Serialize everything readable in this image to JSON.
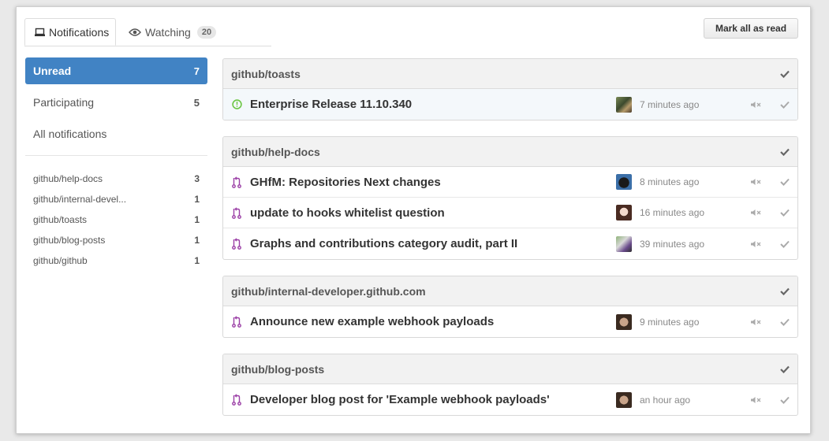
{
  "tabs": {
    "notifications_label": "Notifications",
    "watching_label": "Watching",
    "watching_count": "20"
  },
  "mark_all_label": "Mark all as read",
  "sidebar": {
    "filters": [
      {
        "label": "Unread",
        "count": "7"
      },
      {
        "label": "Participating",
        "count": "5"
      },
      {
        "label": "All notifications",
        "count": ""
      }
    ],
    "repos": [
      {
        "label": "github/help-docs",
        "count": "3"
      },
      {
        "label": "github/internal-devel...",
        "count": "1"
      },
      {
        "label": "github/toasts",
        "count": "1"
      },
      {
        "label": "github/blog-posts",
        "count": "1"
      },
      {
        "label": "github/github",
        "count": "1"
      }
    ]
  },
  "groups": [
    {
      "repo": "github/toasts",
      "items": [
        {
          "title": "Enterprise Release 11.10.340",
          "time": "7 minutes ago",
          "type_icon": "issue-opened-icon"
        }
      ]
    },
    {
      "repo": "github/help-docs",
      "items": [
        {
          "title": "GHfM: Repositories Next changes",
          "time": "8 minutes ago",
          "type_icon": "pull-request-icon"
        },
        {
          "title": "update to hooks whitelist question",
          "time": "16 minutes ago",
          "type_icon": "pull-request-icon"
        },
        {
          "title": "Graphs and contributions category audit, part II",
          "time": "39 minutes ago",
          "type_icon": "pull-request-icon"
        }
      ]
    },
    {
      "repo": "github/internal-developer.github.com",
      "items": [
        {
          "title": "Announce new example webhook payloads",
          "time": "9 minutes ago",
          "type_icon": "pull-request-icon"
        }
      ]
    },
    {
      "repo": "github/blog-posts",
      "items": [
        {
          "title": "Developer blog post for 'Example webhook payloads'",
          "time": "an hour ago",
          "type_icon": "pull-request-icon"
        }
      ]
    }
  ],
  "colors": {
    "accent": "#4183c4",
    "issue_open": "#6cc644",
    "pull_request": "#9b3fa6"
  }
}
